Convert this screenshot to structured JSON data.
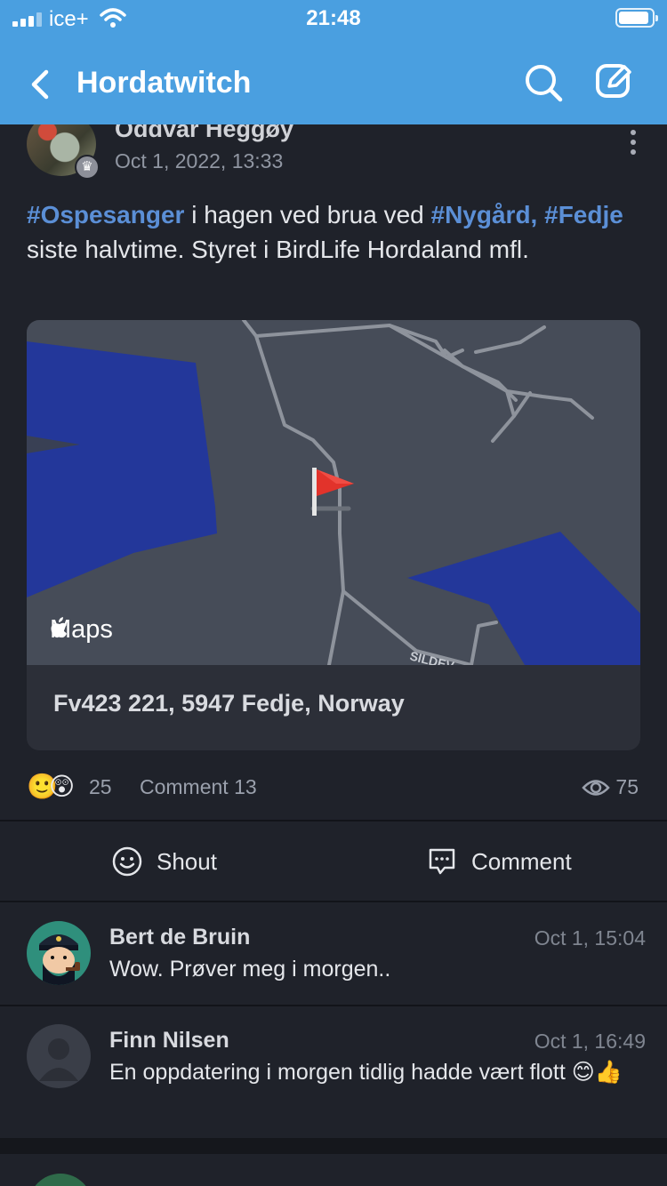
{
  "status_bar": {
    "carrier": "ice+",
    "time": "21:48"
  },
  "nav": {
    "title": "Hordatwitch",
    "icons": [
      "chevron-left-icon",
      "search-icon",
      "compose-icon"
    ]
  },
  "post": {
    "author": "Oddvar Heggøy",
    "date": "Oct 1, 2022, 13:33",
    "text_parts": {
      "tag1": "#Ospesanger",
      "t1": " i hagen ved brua ved ",
      "tag2": "#Nygård,",
      "t2": " ",
      "tag3": "#Fedje",
      "t3": " siste halvtime. Styret i BirdLife Hordaland mfl."
    },
    "map": {
      "logo_text": "Maps",
      "road_label": "SILDEV",
      "address": "Fv423 221, 5947 Fedje, Norway"
    },
    "stats": {
      "reactions_emoji": "🙂😲",
      "reactions_count": "25",
      "comments": "Comment 13",
      "views": "75"
    },
    "actions": {
      "shout": "Shout",
      "comment": "Comment"
    }
  },
  "comments": [
    {
      "name": "Bert de Bruin",
      "time": "Oct 1, 15:04",
      "text": "Wow. Prøver meg i morgen.."
    },
    {
      "name": "Finn Nilsen",
      "time": "Oct 1, 16:49",
      "text": "En oppdatering i morgen tidlig hadde vært flott 😊👍"
    }
  ],
  "colors": {
    "nav_bg": "#4a9fe0",
    "page_bg": "#1f222a",
    "hashtag": "#5b8fd6",
    "water": "#23379a",
    "land": "#464c58"
  }
}
